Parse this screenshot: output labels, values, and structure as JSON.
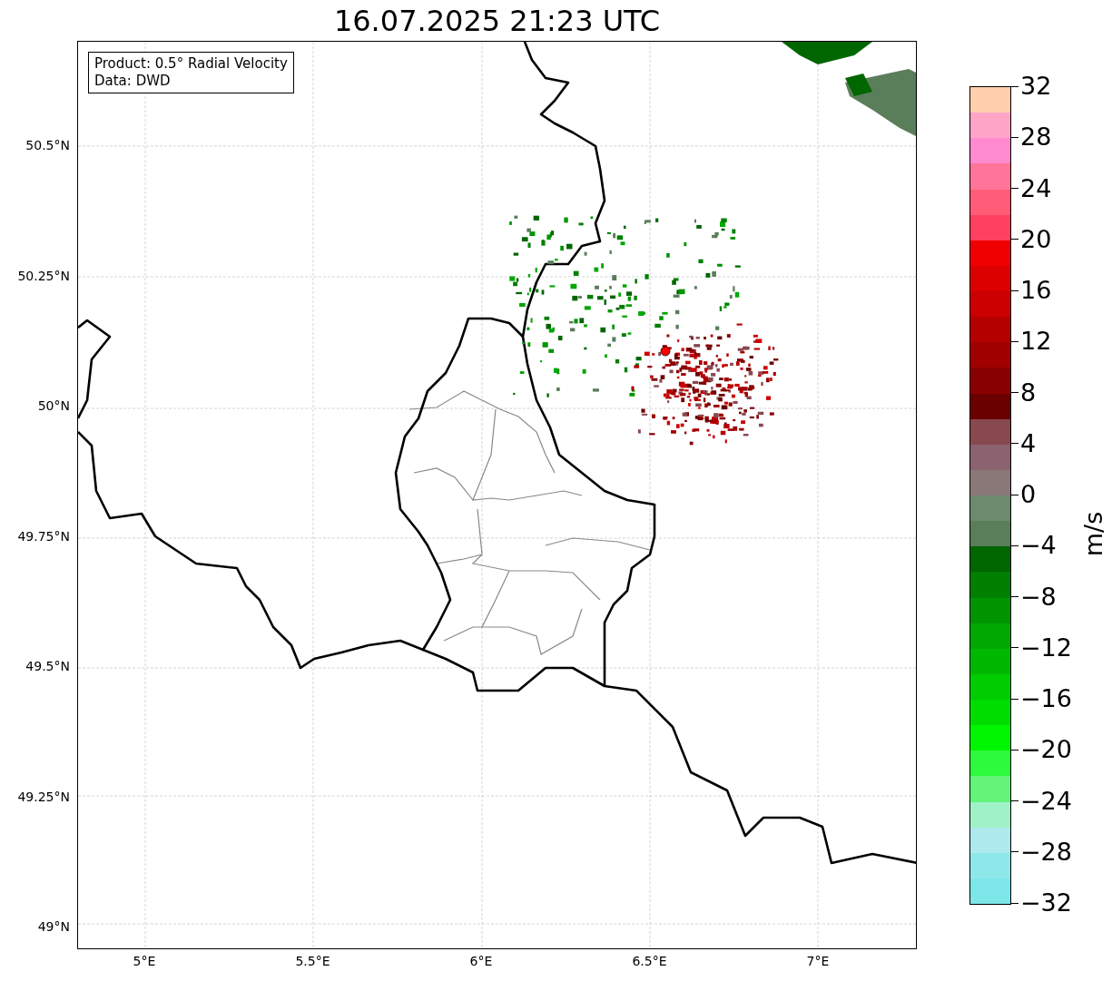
{
  "title": "16.07.2025 21:23 UTC",
  "legend": {
    "lines": [
      "Product: 0.5° Radial Velocity",
      "Data: DWD"
    ]
  },
  "lat_ticks": [
    "50.5°N",
    "50.25°N",
    "50°N",
    "49.75°N",
    "49.5°N",
    "49.25°N",
    "49°N"
  ],
  "lon_ticks": [
    "5°E",
    "5.5°E",
    "6°E",
    "6.5°E",
    "7°E"
  ],
  "colorbar": {
    "unit": "m/s",
    "ticks": [
      "32",
      "28",
      "24",
      "20",
      "16",
      "12",
      "8",
      "4",
      "0",
      "−4",
      "−8",
      "−12",
      "−16",
      "−20",
      "−24",
      "−28",
      "−32"
    ],
    "bands": [
      {
        "color": "#ffcfae"
      },
      {
        "color": "#ffa6c8"
      },
      {
        "color": "#ff8ad0"
      },
      {
        "color": "#ff7499"
      },
      {
        "color": "#ff5c78"
      },
      {
        "color": "#ff4060"
      },
      {
        "color": "#f00000"
      },
      {
        "color": "#dd0000"
      },
      {
        "color": "#cc0000"
      },
      {
        "color": "#b50000"
      },
      {
        "color": "#a00000"
      },
      {
        "color": "#880000"
      },
      {
        "color": "#6b0000"
      },
      {
        "color": "#884850"
      },
      {
        "color": "#8a6270"
      },
      {
        "color": "#8a7878"
      },
      {
        "color": "#6e8a6e"
      },
      {
        "color": "#5a7d5a"
      },
      {
        "color": "#006600"
      },
      {
        "color": "#007f00"
      },
      {
        "color": "#009400"
      },
      {
        "color": "#00a800"
      },
      {
        "color": "#00b800"
      },
      {
        "color": "#00cc00"
      },
      {
        "color": "#00dd00"
      },
      {
        "color": "#00f500"
      },
      {
        "color": "#2dfa3c"
      },
      {
        "color": "#64f47a"
      },
      {
        "color": "#9ff2c8"
      },
      {
        "color": "#ade9ed"
      },
      {
        "color": "#8ee8ea"
      },
      {
        "color": "#7de6e8"
      }
    ]
  }
}
